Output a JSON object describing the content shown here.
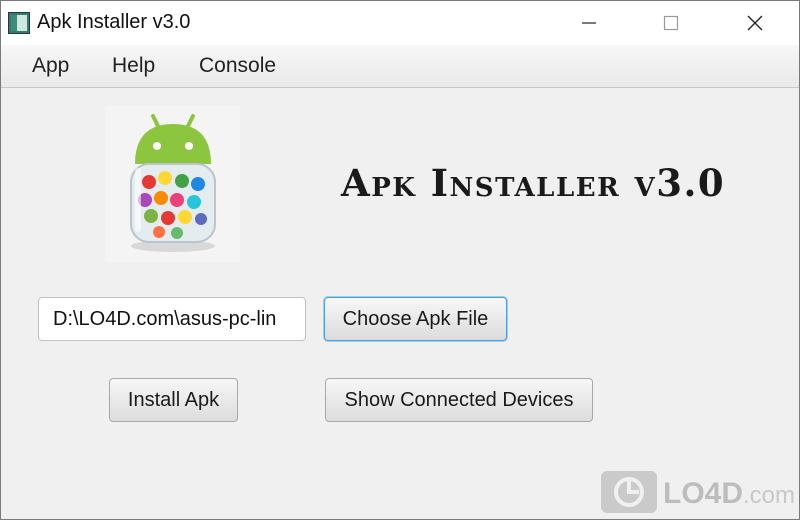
{
  "window": {
    "title": "Apk Installer v3.0"
  },
  "menu": {
    "items": [
      "App",
      "Help",
      "Console"
    ]
  },
  "main": {
    "heading": "Apk Installer v3.0",
    "apk_path_value": "D:\\LO4D.com\\asus-pc-lin",
    "choose_button": "Choose Apk File",
    "install_button": "Install Apk",
    "devices_button": "Show Connected Devices"
  },
  "watermark": {
    "brand": "LO4D",
    "suffix": ".com"
  },
  "colors": {
    "accent": "#4d9fd8",
    "window_bg": "#f0f0f0",
    "titlebar_bg": "#ffffff"
  }
}
